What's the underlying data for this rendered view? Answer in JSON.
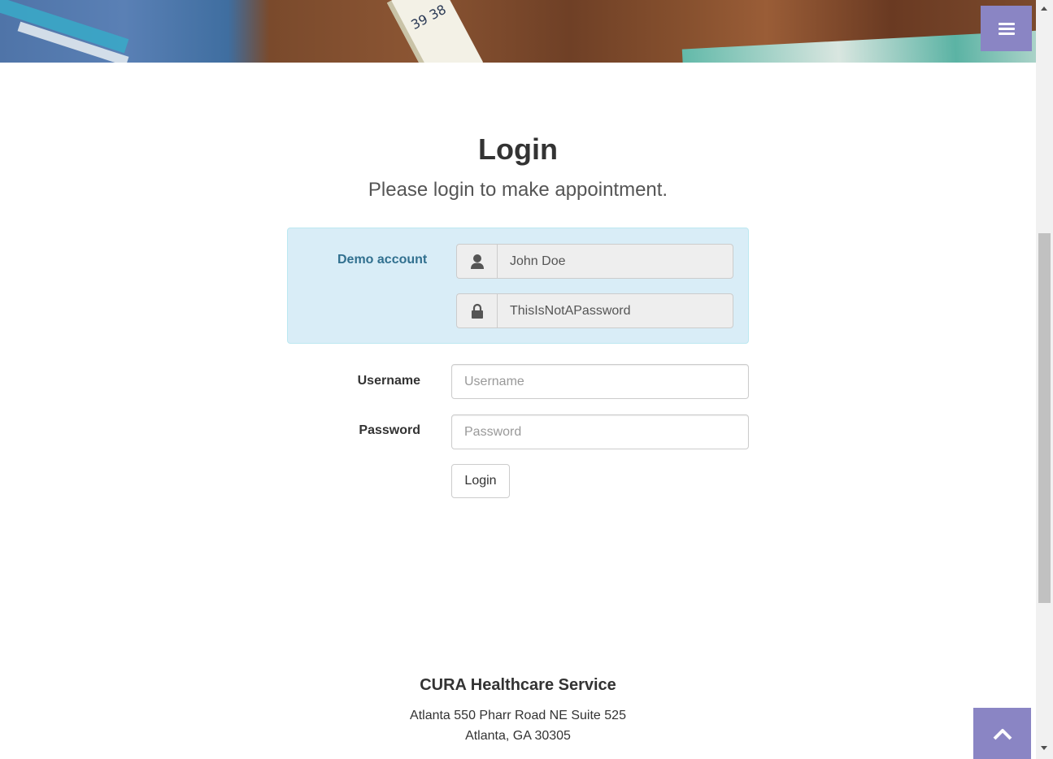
{
  "header": {
    "menu_icon": "bars-icon"
  },
  "login": {
    "title": "Login",
    "subtitle": "Please login to make appointment.",
    "demo": {
      "label": "Demo account",
      "username": "John Doe",
      "password": "ThisIsNotAPassword",
      "user_icon": "user-icon",
      "lock_icon": "lock-icon"
    },
    "form": {
      "username_label": "Username",
      "username_placeholder": "Username",
      "password_label": "Password",
      "password_placeholder": "Password",
      "submit_label": "Login"
    }
  },
  "footer": {
    "title": "CURA Healthcare Service",
    "address_line1": "Atlanta 550 Pharr Road NE Suite 525",
    "address_line2": "Atlanta, GA 30305"
  },
  "scroll_top_icon": "chevron-up-icon",
  "colors": {
    "accent": "#8a85c4",
    "demo_bg": "#d9edf7",
    "demo_text": "#31708f"
  }
}
